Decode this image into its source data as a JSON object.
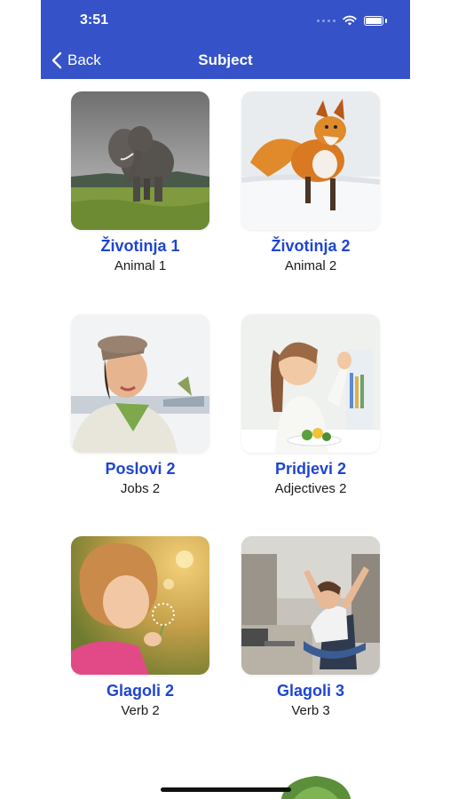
{
  "status_bar": {
    "time": "3:51"
  },
  "nav": {
    "back_label": "Back",
    "title": "Subject"
  },
  "subjects": [
    {
      "title": "Životinja 1",
      "subtitle": "Animal 1",
      "image": "elephant-photo"
    },
    {
      "title": "Životinja 2",
      "subtitle": "Animal 2",
      "image": "fox-photo"
    },
    {
      "title": "Poslovi 2",
      "subtitle": "Jobs 2",
      "image": "flight-attendant-photo"
    },
    {
      "title": "Pridjevi 2",
      "subtitle": "Adjectives 2",
      "image": "girl-thumbs-up-photo"
    },
    {
      "title": "Glagoli 2",
      "subtitle": "Verb 2",
      "image": "girl-blowing-dandelion-photo"
    },
    {
      "title": "Glagoli 3",
      "subtitle": "Verb 3",
      "image": "woman-stretching-photo"
    }
  ],
  "colors": {
    "nav_bar": "#3552c8",
    "subject_title": "#1f45d1"
  }
}
